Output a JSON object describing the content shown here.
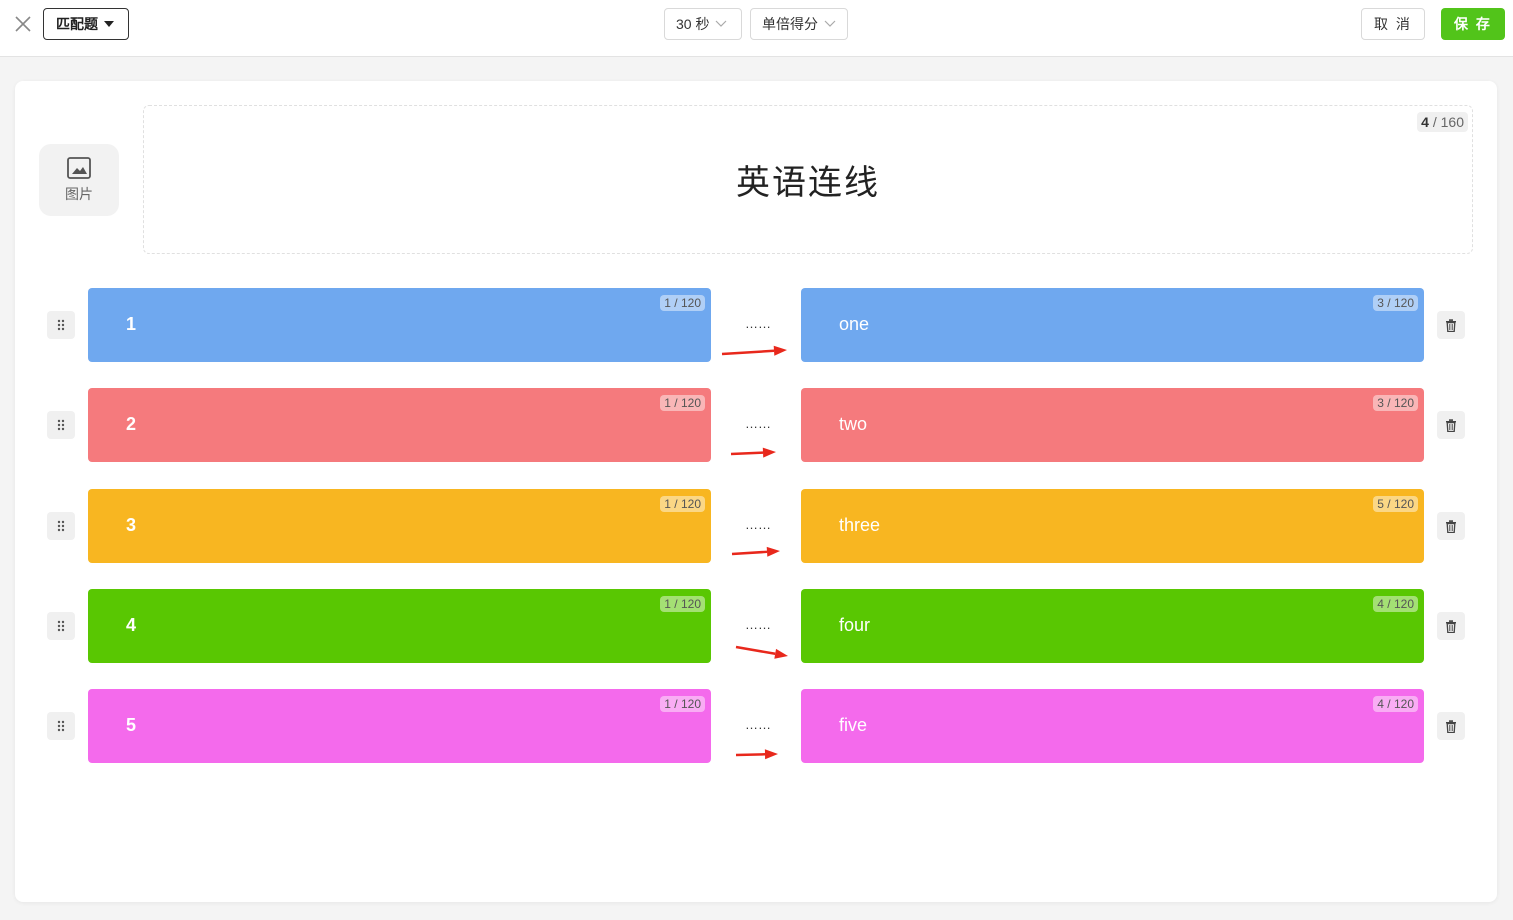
{
  "header": {
    "question_type": "匹配题",
    "time_limit": "30 秒",
    "scoring": "单倍得分",
    "cancel_label": "取 消",
    "save_label": "保 存",
    "accent_color": "#52c41a"
  },
  "question": {
    "image_label": "图片",
    "title": "英语连线",
    "title_count": "4",
    "title_max": " / 160"
  },
  "pairs": [
    {
      "left": "1",
      "left_count": "1 / 120",
      "connector": "……",
      "right": "one",
      "right_count": "3 / 120",
      "color": "#6fa8ef"
    },
    {
      "left": "2",
      "left_count": "1 / 120",
      "connector": "……",
      "right": "two",
      "right_count": "3 / 120",
      "color": "#f57a7d"
    },
    {
      "left": "3",
      "left_count": "1 / 120",
      "connector": "……",
      "right": "three",
      "right_count": "5 / 120",
      "color": "#f8b621"
    },
    {
      "left": "4",
      "left_count": "1 / 120",
      "connector": "……",
      "right": "four",
      "right_count": "4 / 120",
      "color": "#59c702"
    },
    {
      "left": "5",
      "left_count": "1 / 120",
      "connector": "……",
      "right": "five",
      "right_count": "4 / 120",
      "color": "#f46aec"
    }
  ],
  "icons": {
    "close": "close-icon",
    "dropdown": "chevron-down-icon",
    "image": "image-icon",
    "drag": "drag-handle-icon",
    "delete": "trash-icon",
    "arrow": "arrow-right-icon"
  },
  "arrow_color": "#e8281c"
}
